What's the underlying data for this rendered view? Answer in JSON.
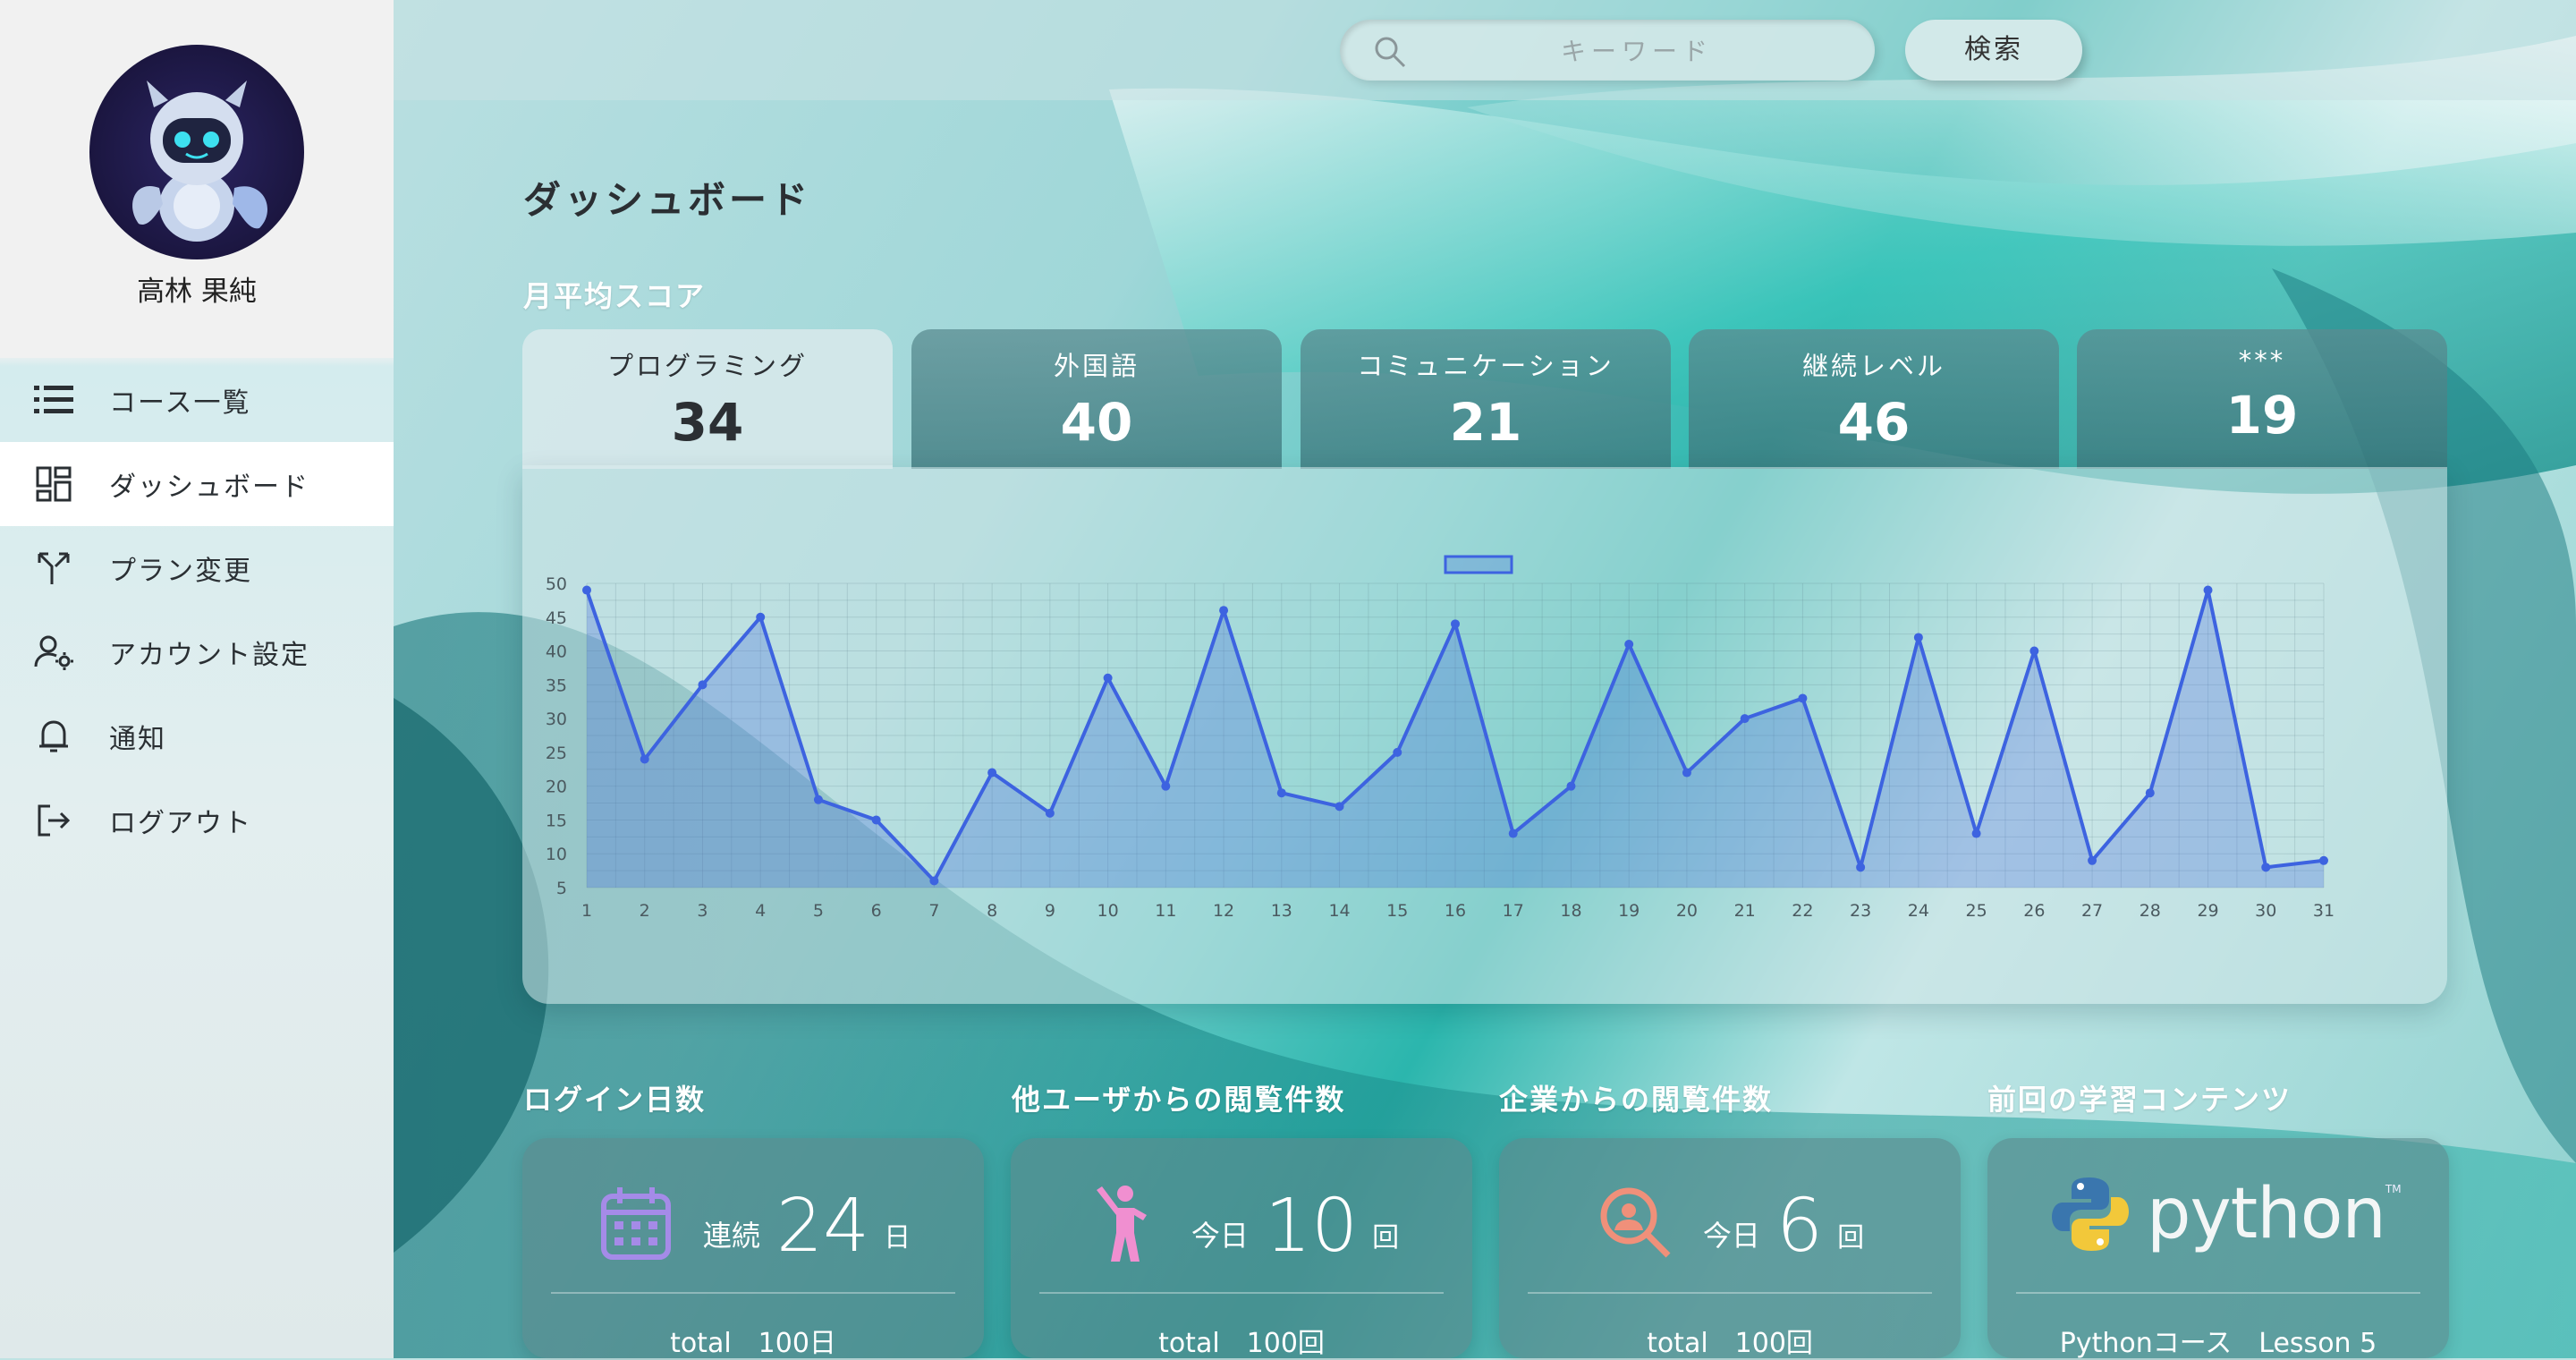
{
  "user": {
    "name": "高林 果純"
  },
  "nav": {
    "items": [
      {
        "label": "コース一覧",
        "icon": "list-icon"
      },
      {
        "label": "ダッシュボード",
        "icon": "dashboard-icon",
        "active": true
      },
      {
        "label": "プラン変更",
        "icon": "split-arrows-icon"
      },
      {
        "label": "アカウント設定",
        "icon": "user-gear-icon"
      },
      {
        "label": "通知",
        "icon": "bell-icon"
      },
      {
        "label": "ログアウト",
        "icon": "logout-icon"
      }
    ]
  },
  "search": {
    "placeholder": "キーワード",
    "value": "",
    "button_label": "検索"
  },
  "page": {
    "title": "ダッシュボード",
    "score_section_label": "月平均スコア"
  },
  "score_tabs": [
    {
      "label": "プログラミング",
      "value": "34",
      "active": true
    },
    {
      "label": "外国語",
      "value": "40"
    },
    {
      "label": "コミュニケーション",
      "value": "21"
    },
    {
      "label": "継続レベル",
      "value": "46"
    },
    {
      "label": "***",
      "value": "19"
    }
  ],
  "chart_data": {
    "type": "area",
    "title": "",
    "xlabel": "",
    "ylabel": "",
    "x": [
      1,
      2,
      3,
      4,
      5,
      6,
      7,
      8,
      9,
      10,
      11,
      12,
      13,
      14,
      15,
      16,
      17,
      18,
      19,
      20,
      21,
      22,
      23,
      24,
      25,
      26,
      27,
      28,
      29,
      30,
      31
    ],
    "series": [
      {
        "values": [
          49,
          24,
          35,
          45,
          18,
          15,
          6,
          22,
          16,
          36,
          20,
          46,
          19,
          17,
          25,
          44,
          13,
          20,
          41,
          22,
          30,
          33,
          8,
          42,
          13,
          40,
          9,
          19,
          49,
          8,
          9
        ]
      }
    ],
    "xticks": [
      "1",
      "2",
      "3",
      "4",
      "5",
      "6",
      "7",
      "8",
      "9",
      "10",
      "11",
      "12",
      "13",
      "14",
      "15",
      "16",
      "17",
      "18",
      "19",
      "20",
      "21",
      "22",
      "23",
      "24",
      "25",
      "26",
      "27",
      "28",
      "29",
      "30",
      "31"
    ],
    "yticks": [
      "5",
      "10",
      "15",
      "20",
      "25",
      "30",
      "35",
      "40",
      "45",
      "50"
    ],
    "ylim": [
      5,
      50
    ],
    "grid": true,
    "legend": "top-center",
    "color": "#3d63e0"
  },
  "stats": {
    "login_days": {
      "label": "ログイン日数",
      "prefix": "連続",
      "value": "24",
      "unit": "日",
      "total": "total　100日",
      "icon": "calendar-icon"
    },
    "user_views": {
      "label": "他ユーザからの閲覧件数",
      "prefix": "今日",
      "value": "10",
      "unit": "回",
      "total": "total　100回",
      "icon": "person-icon"
    },
    "company_views": {
      "label": "企業からの閲覧件数",
      "prefix": "今日",
      "value": "6",
      "unit": "回",
      "total": "total　100回",
      "icon": "search-person-icon"
    },
    "last_content": {
      "label": "前回の学習コンテンツ",
      "logo_text": "python",
      "tm": "TM",
      "course": "Pythonコース　Lesson 5",
      "icon": "python-logo-icon"
    }
  },
  "colors": {
    "accent": "#3d63e0",
    "calendar": "#a58be8",
    "person": "#f08fd0",
    "search_person": "#f0907a"
  }
}
